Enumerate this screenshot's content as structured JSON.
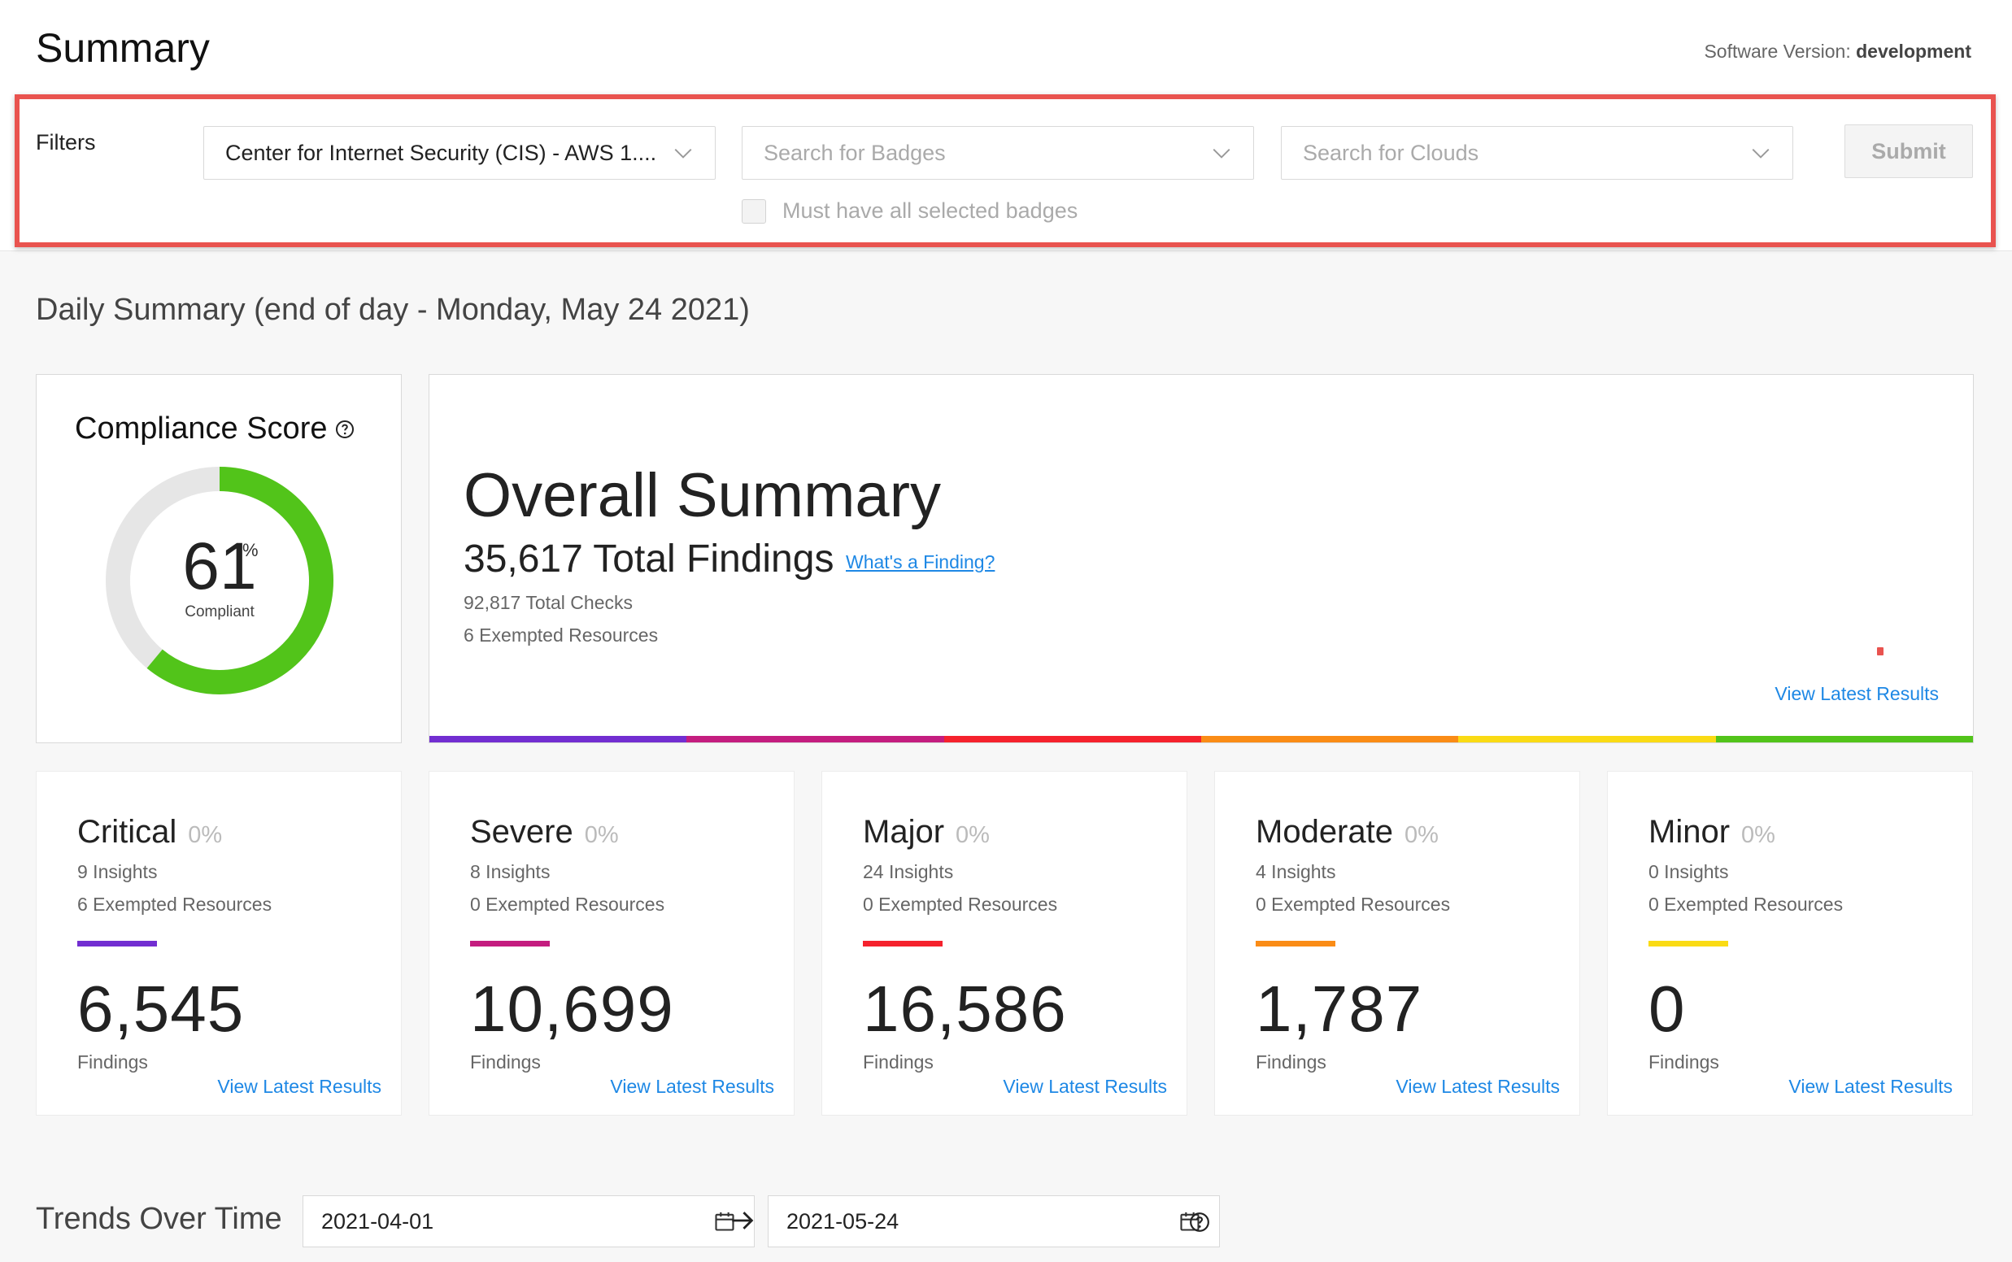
{
  "header": {
    "title": "Summary",
    "version_label": "Software Version:",
    "version_value": "development"
  },
  "filters": {
    "label": "Filters",
    "standard": {
      "value": "Center for Internet Security (CIS) - AWS 1...."
    },
    "badges": {
      "placeholder": "Search for Badges"
    },
    "clouds": {
      "placeholder": "Search for Clouds"
    },
    "submit_label": "Submit",
    "must_have_all_label": "Must have all selected badges"
  },
  "daily": {
    "title": "Daily Summary (end of day - Monday, May 24 2021)"
  },
  "compliance": {
    "title": "Compliance Score",
    "score": 61,
    "score_text": "61",
    "pct_symbol": "%",
    "label": "Compliant",
    "colors": {
      "fill": "#52c41a",
      "track": "#e6e6e6"
    }
  },
  "overall": {
    "title": "Overall Summary",
    "total_findings": "35,617 Total Findings",
    "whats_link": "What's a Finding?",
    "total_checks": "92,817 Total Checks",
    "exempted": "6 Exempted Resources",
    "view_link": "View Latest Results",
    "rainbow": [
      "#722ed1",
      "#c41d7f",
      "#f5222d",
      "#fa8c16",
      "#fadb14",
      "#52c41a"
    ]
  },
  "severities": [
    {
      "name": "Critical",
      "pct": "0%",
      "insights": "9 Insights",
      "exempted": "6 Exempted Resources",
      "count": "6,545",
      "findings_label": "Findings",
      "link": "View Latest Results",
      "color": "#722ed1"
    },
    {
      "name": "Severe",
      "pct": "0%",
      "insights": "8 Insights",
      "exempted": "0 Exempted Resources",
      "count": "10,699",
      "findings_label": "Findings",
      "link": "View Latest Results",
      "color": "#c41d7f"
    },
    {
      "name": "Major",
      "pct": "0%",
      "insights": "24 Insights",
      "exempted": "0 Exempted Resources",
      "count": "16,586",
      "findings_label": "Findings",
      "link": "View Latest Results",
      "color": "#f5222d"
    },
    {
      "name": "Moderate",
      "pct": "0%",
      "insights": "4 Insights",
      "exempted": "0 Exempted Resources",
      "count": "1,787",
      "findings_label": "Findings",
      "link": "View Latest Results",
      "color": "#fa8c16"
    },
    {
      "name": "Minor",
      "pct": "0%",
      "insights": "0 Insights",
      "exempted": "0 Exempted Resources",
      "count": "0",
      "findings_label": "Findings",
      "link": "View Latest Results",
      "color": "#fadb14"
    }
  ],
  "trends": {
    "title": "Trends Over Time",
    "start_date": "2021-04-01",
    "end_date": "2021-05-24"
  },
  "icons": {
    "chevron": "chevron-down-icon",
    "help": "question-circle-icon",
    "calendar": "calendar-icon",
    "arrow": "arrow-right-icon"
  }
}
